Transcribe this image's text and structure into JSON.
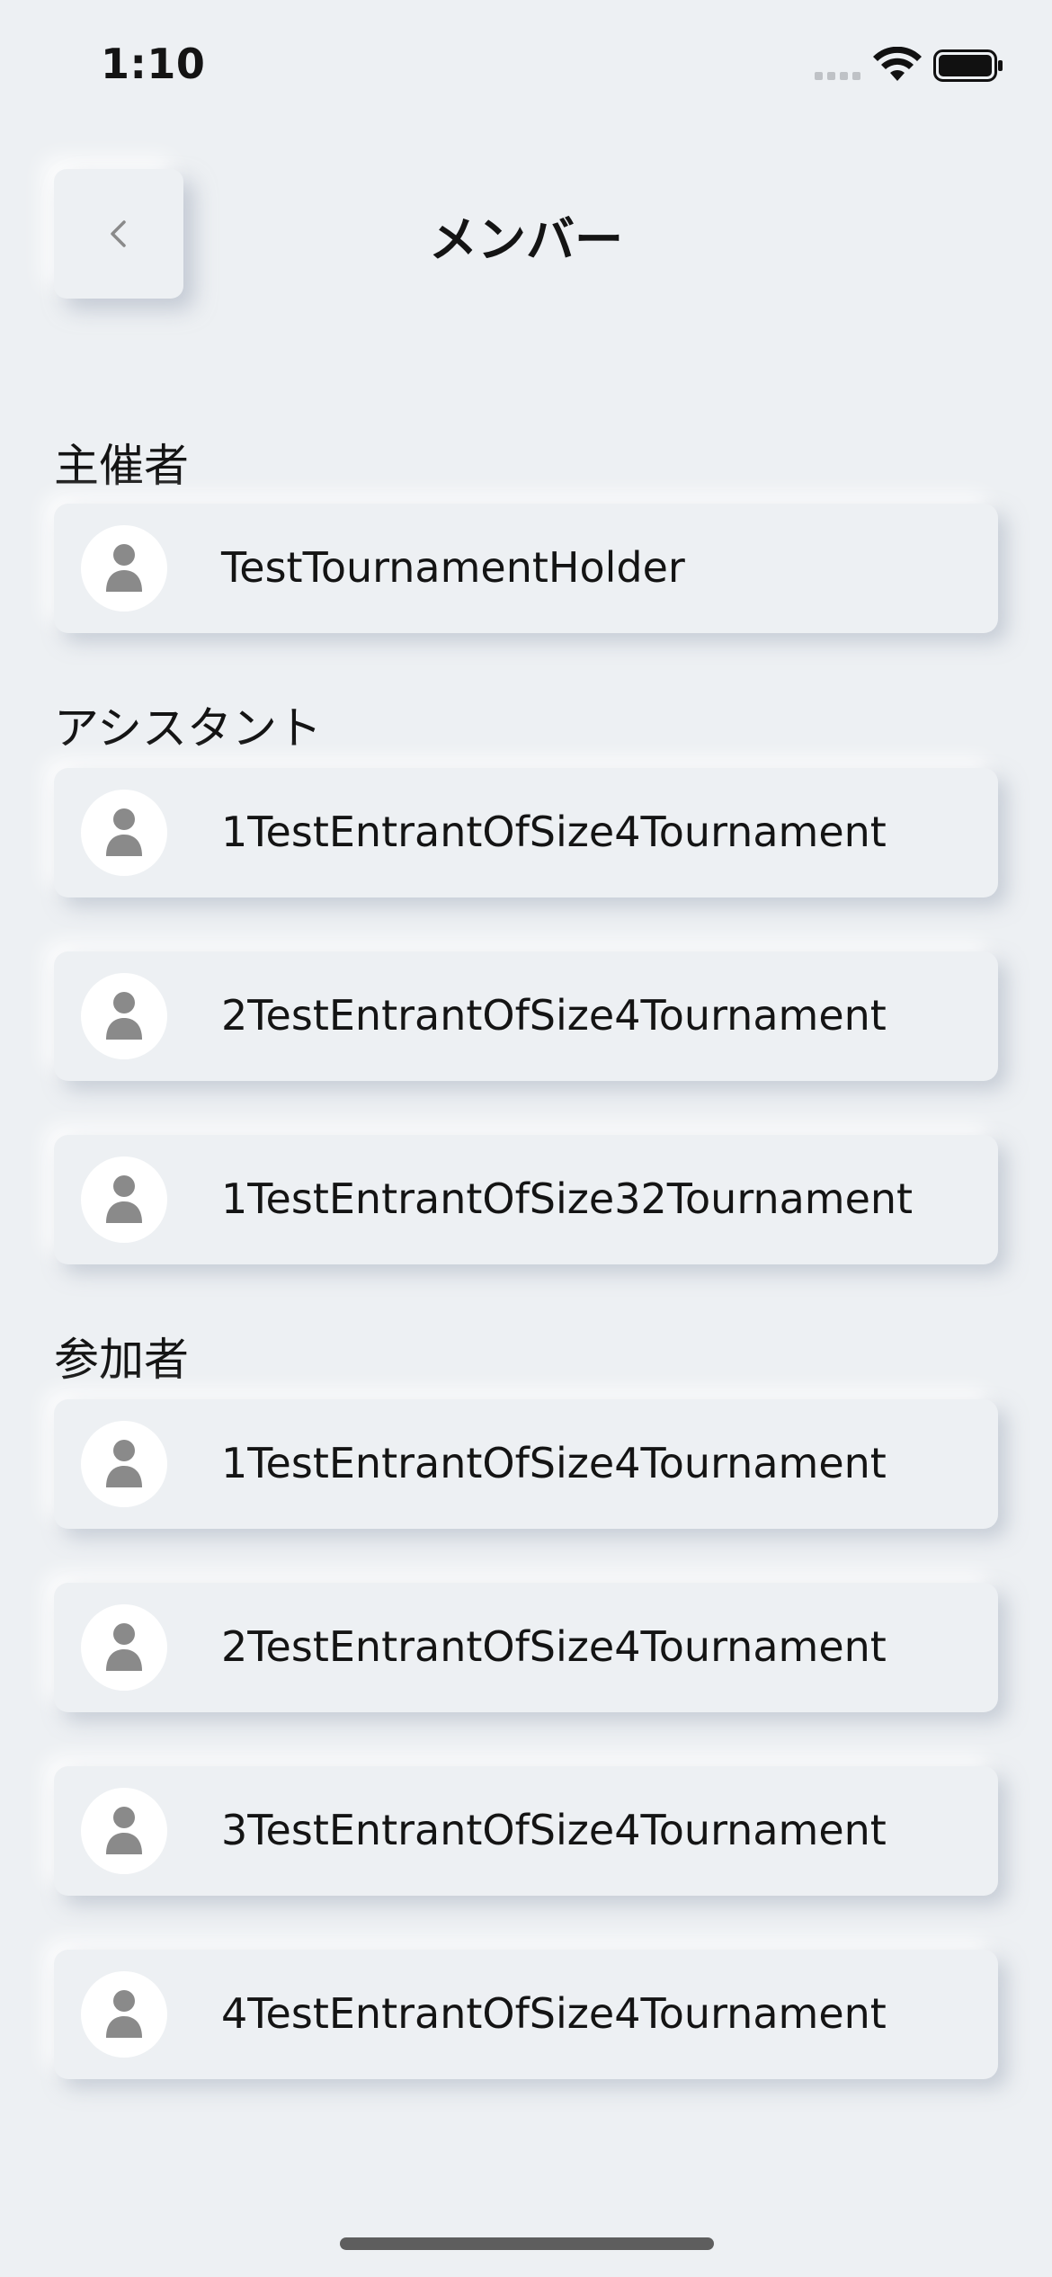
{
  "status_bar": {
    "time": "1:10"
  },
  "header": {
    "title": "メンバー",
    "back_icon": "chevron-left-icon"
  },
  "sections": [
    {
      "label": "主催者",
      "members": [
        {
          "name": "TestTournamentHolder",
          "avatar_icon": "person-icon"
        }
      ]
    },
    {
      "label": "アシスタント",
      "members": [
        {
          "name": "1TestEntrantOfSize4Tournament",
          "avatar_icon": "person-icon"
        },
        {
          "name": "2TestEntrantOfSize4Tournament",
          "avatar_icon": "person-icon"
        },
        {
          "name": "1TestEntrantOfSize32Tournament",
          "avatar_icon": "person-icon"
        }
      ]
    },
    {
      "label": "参加者",
      "members": [
        {
          "name": "1TestEntrantOfSize4Tournament",
          "avatar_icon": "person-icon"
        },
        {
          "name": "2TestEntrantOfSize4Tournament",
          "avatar_icon": "person-icon"
        },
        {
          "name": "3TestEntrantOfSize4Tournament",
          "avatar_icon": "person-icon"
        },
        {
          "name": "4TestEntrantOfSize4Tournament",
          "avatar_icon": "person-icon"
        }
      ]
    }
  ],
  "colors": {
    "background": "#edf0f3",
    "text": "#141414",
    "avatar_icon": "#8a8a8a"
  }
}
